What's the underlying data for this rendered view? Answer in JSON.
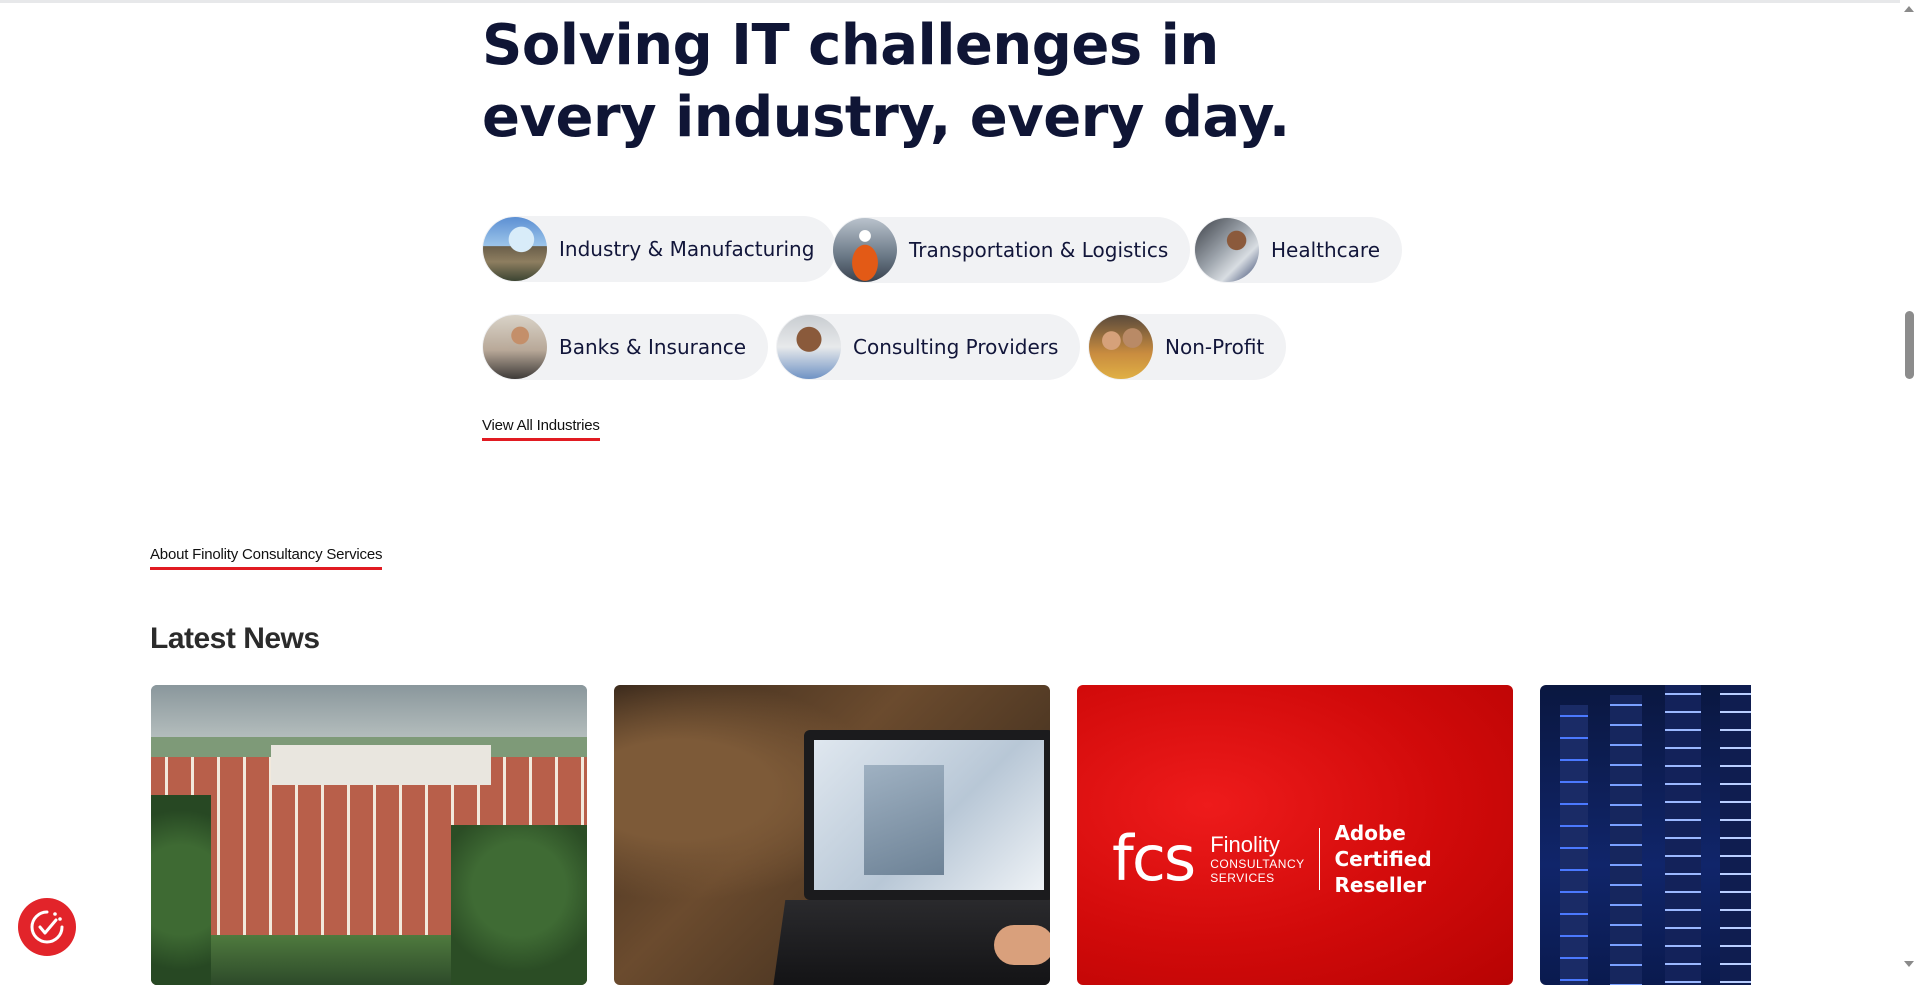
{
  "headline": "Solving IT challenges in every industry, every day.",
  "industries": [
    {
      "label": "Industry & Manufacturing",
      "icon": "factory-photo"
    },
    {
      "label": "Transportation & Logistics",
      "icon": "worker-photo"
    },
    {
      "label": "Healthcare",
      "icon": "healthcare-photo"
    },
    {
      "label": "Banks & Insurance",
      "icon": "banker-photo"
    },
    {
      "label": "Consulting Providers",
      "icon": "consultant-photo"
    },
    {
      "label": "Non-Profit",
      "icon": "volunteers-photo"
    }
  ],
  "view_all_label": "View All Industries",
  "about_label": "About Finolity Consultancy Services",
  "news": {
    "title": "Latest News",
    "cards": [
      {
        "image": "campus-photo"
      },
      {
        "image": "laptop-photo"
      },
      {
        "image": "fcs-adobe-banner",
        "logo_mark": "fcs",
        "logo_name": "Finolity",
        "logo_sub1": "CONSULTANCY",
        "logo_sub2": "SERVICES",
        "partner_line1": "Adobe",
        "partner_line2": "Certified Reseller"
      },
      {
        "image": "server-room-photo"
      }
    ]
  },
  "colors": {
    "accent": "#e11b22",
    "heading": "#0f1535",
    "pill_bg": "#f1f2f4"
  },
  "consent_icon": "cookie-consent-icon"
}
